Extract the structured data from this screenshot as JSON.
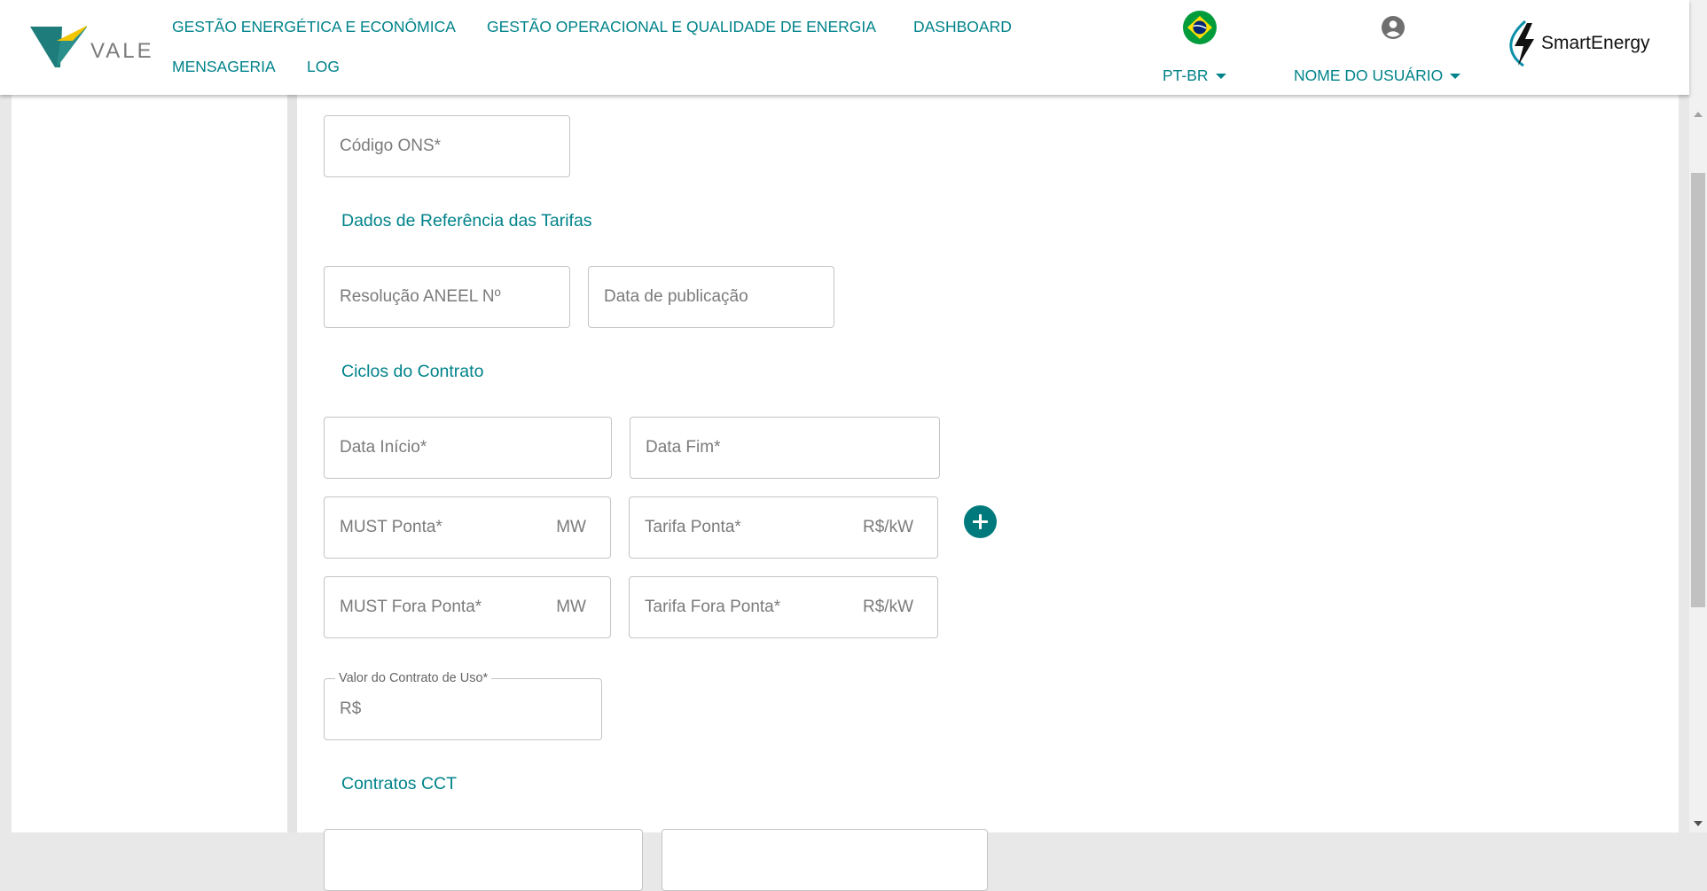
{
  "header": {
    "brand_left": "VALE",
    "brand_right": "SmartEnergy",
    "nav": [
      "GESTÃO ENERGÉTICA E ECONÔMICA",
      "GESTÃO OPERACIONAL E QUALIDADE DE ENERGIA",
      "DASHBOARD",
      "MENSAGERIA",
      "LOG"
    ],
    "language": "PT-BR",
    "user": "NOME DO USUÁRIO",
    "flag_icon": "brazil-flag-icon",
    "user_icon": "account-circle-icon"
  },
  "form": {
    "codigo_ons": "Código ONS*",
    "section_tarifas": "Dados de Referência das Tarifas",
    "resolucao": "Resolução ANEEL Nº",
    "data_publicacao": "Data de publicação",
    "section_ciclos": "Ciclos do Contrato",
    "data_inicio": "Data Início*",
    "data_fim": "Data Fim*",
    "must_ponta": "MUST Ponta*",
    "must_ponta_unit": "MW",
    "tarifa_ponta": "Tarifa Ponta*",
    "tarifa_ponta_unit": "R$/kW",
    "must_fora_ponta": "MUST Fora Ponta*",
    "must_fora_ponta_unit": "MW",
    "tarifa_fora_ponta": "Tarifa Fora Ponta*",
    "tarifa_fora_ponta_unit": "R$/kW",
    "valor_contrato_label": "Valor do Contrato de Uso*",
    "valor_contrato_prefix": "R$",
    "section_cct": "Contratos CCT",
    "add_icon": "plus-circle-icon"
  },
  "colors": {
    "accent": "#00838a",
    "add_button": "#00797c",
    "field_border": "#c4c4c4"
  }
}
